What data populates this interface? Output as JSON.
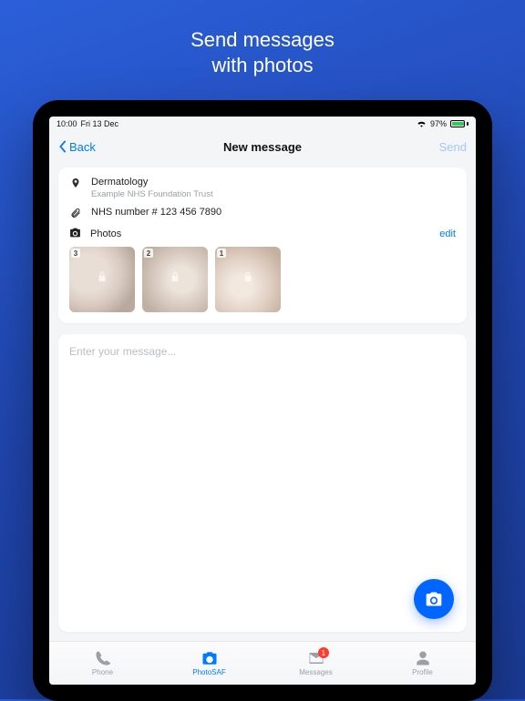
{
  "hero": {
    "line1": "Send messages",
    "line2": "with photos"
  },
  "statusbar": {
    "time": "10:00",
    "date": "Fri 13 Dec",
    "battery": "97%"
  },
  "navbar": {
    "back": "Back",
    "title": "New message",
    "send": "Send"
  },
  "location": {
    "title": "Dermatology",
    "subtitle": "Example NHS Foundation Trust"
  },
  "attachment": {
    "text": "NHS number # 123 456 7890"
  },
  "photos_section": {
    "label": "Photos",
    "edit": "edit"
  },
  "photos": [
    {
      "number": "3"
    },
    {
      "number": "2"
    },
    {
      "number": "1"
    }
  ],
  "message": {
    "placeholder": "Enter your message..."
  },
  "tabs": {
    "phone": "Phone",
    "photosaf": "PhotoSAF",
    "messages": "Messages",
    "profile": "Profile",
    "badge": "1"
  }
}
